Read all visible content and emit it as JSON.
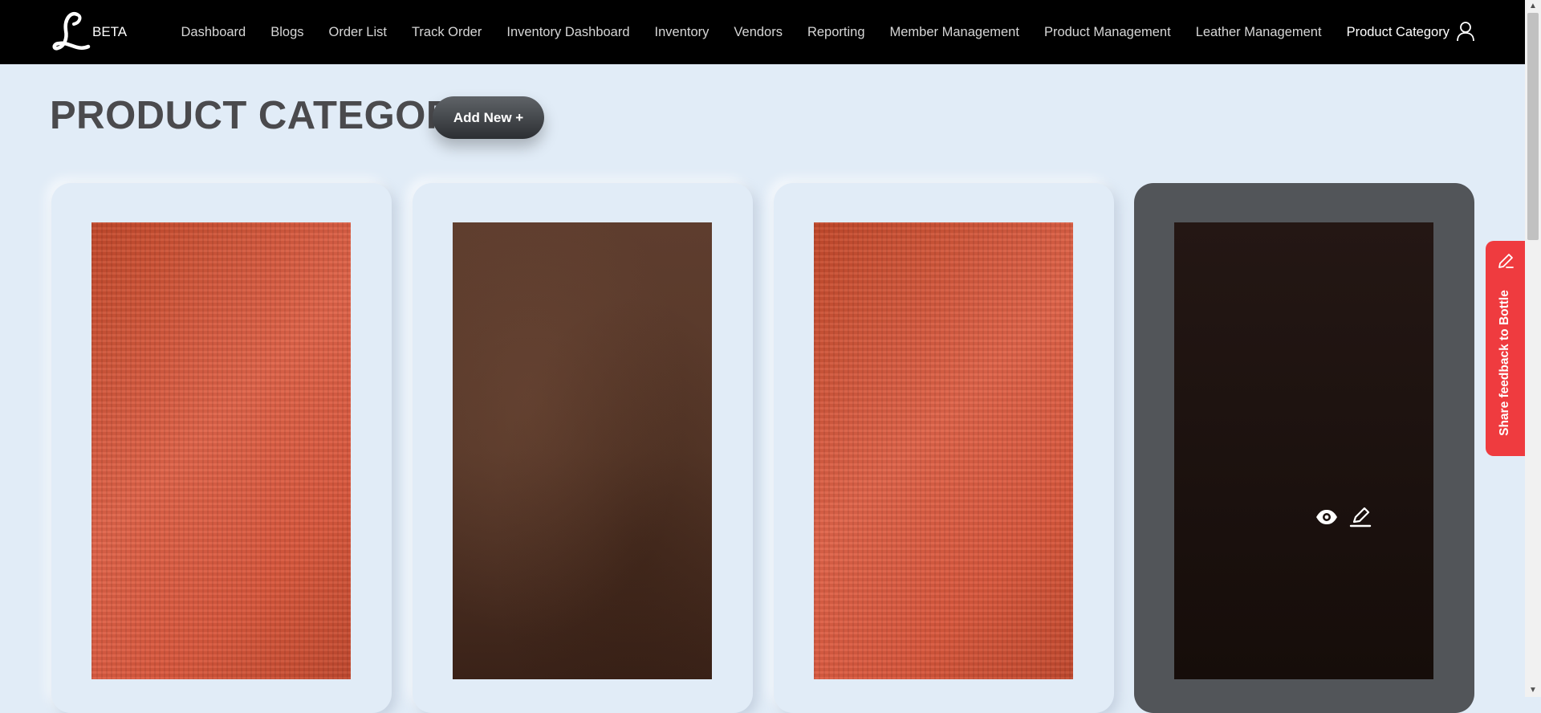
{
  "brand": {
    "logo_letter": "L",
    "badge": "BETA"
  },
  "nav": {
    "items": [
      {
        "label": "Dashboard",
        "active": false
      },
      {
        "label": "Blogs",
        "active": false
      },
      {
        "label": "Order List",
        "active": false
      },
      {
        "label": "Track Order",
        "active": false
      },
      {
        "label": "Inventory Dashboard",
        "active": false
      },
      {
        "label": "Inventory",
        "active": false
      },
      {
        "label": "Vendors",
        "active": false
      },
      {
        "label": "Reporting",
        "active": false
      },
      {
        "label": "Member Management",
        "active": false
      },
      {
        "label": "Product Management",
        "active": false
      },
      {
        "label": "Leather Management",
        "active": false
      },
      {
        "label": "Product Category",
        "active": true
      }
    ],
    "user_icon": "user-icon"
  },
  "page": {
    "title": "PRODUCT CATEGORY",
    "add_button": "Add New +"
  },
  "cards": [
    {
      "swatch": "orange",
      "selected": false
    },
    {
      "swatch": "brown",
      "selected": false
    },
    {
      "swatch": "orange",
      "selected": false
    },
    {
      "swatch": "dark",
      "selected": true,
      "actions": [
        "eye-icon",
        "edit-icon"
      ]
    }
  ],
  "feedback": {
    "label": "Share feedback to Bottle",
    "icon": "pencil-icon",
    "color": "#ef3b3f"
  },
  "colors": {
    "background": "#e1ecf7",
    "navbar": "#000000",
    "selected_card": "#525559"
  }
}
